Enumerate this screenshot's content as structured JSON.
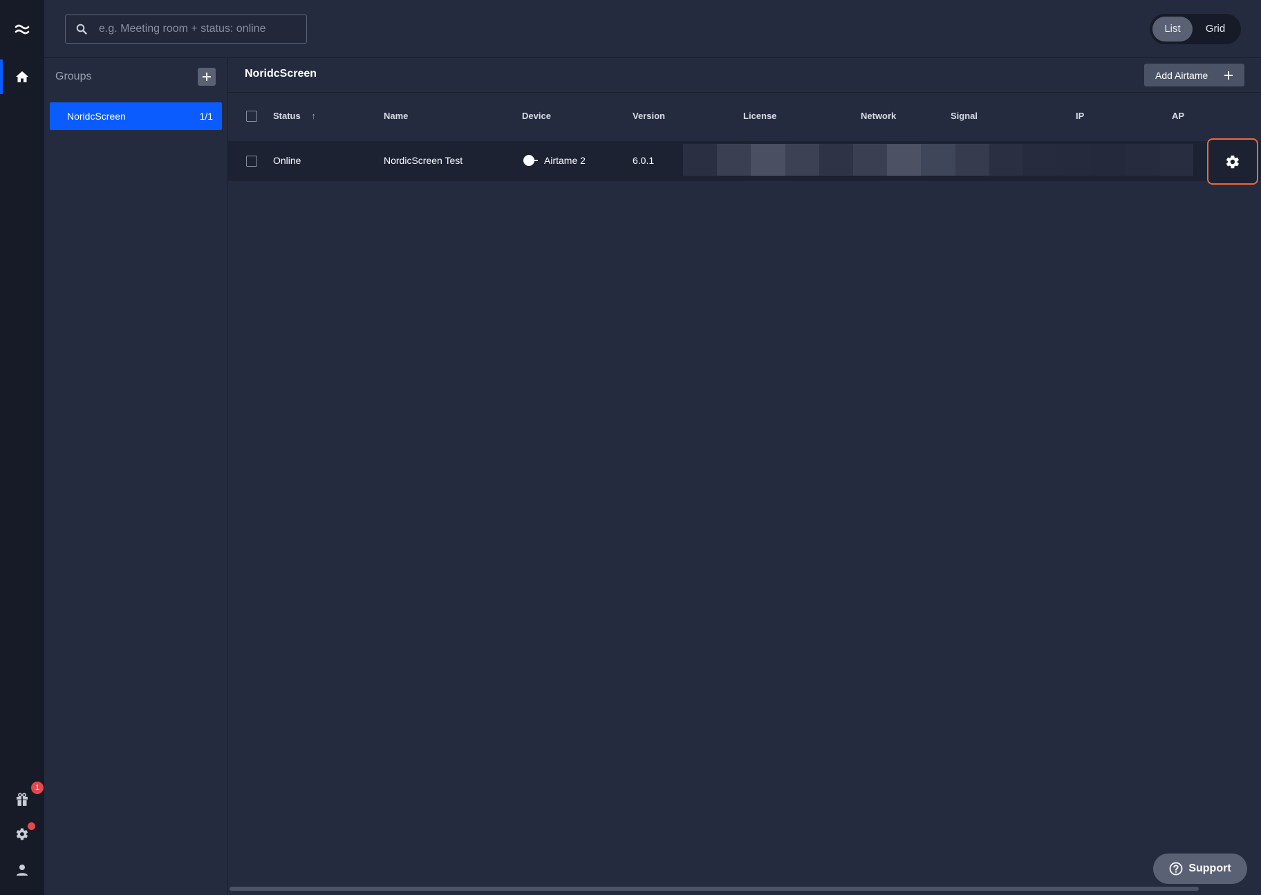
{
  "rail": {
    "notification_count": "1"
  },
  "search": {
    "placeholder": "e.g. Meeting room + status: online",
    "value": ""
  },
  "view_toggle": {
    "list_label": "List",
    "grid_label": "Grid",
    "selected": "List"
  },
  "groups": {
    "header": "Groups",
    "items": [
      {
        "name": "NoridcScreen",
        "count": "1/1"
      }
    ]
  },
  "main": {
    "title": "NoridcScreen",
    "add_button_label": "Add Airtame",
    "columns": [
      "Status",
      "Name",
      "Device",
      "Version",
      "License",
      "Network",
      "Signal",
      "IP",
      "AP"
    ],
    "sort_indicator": "↑",
    "rows": [
      {
        "status": "Online",
        "name": "NordicScreen Test",
        "device": "Airtame 2",
        "version": "6.0.1"
      }
    ]
  },
  "support": {
    "label": "Support"
  },
  "colors": {
    "accent": "#0a5cff",
    "highlight": "#ee6a3b",
    "badge": "#e5484d"
  }
}
